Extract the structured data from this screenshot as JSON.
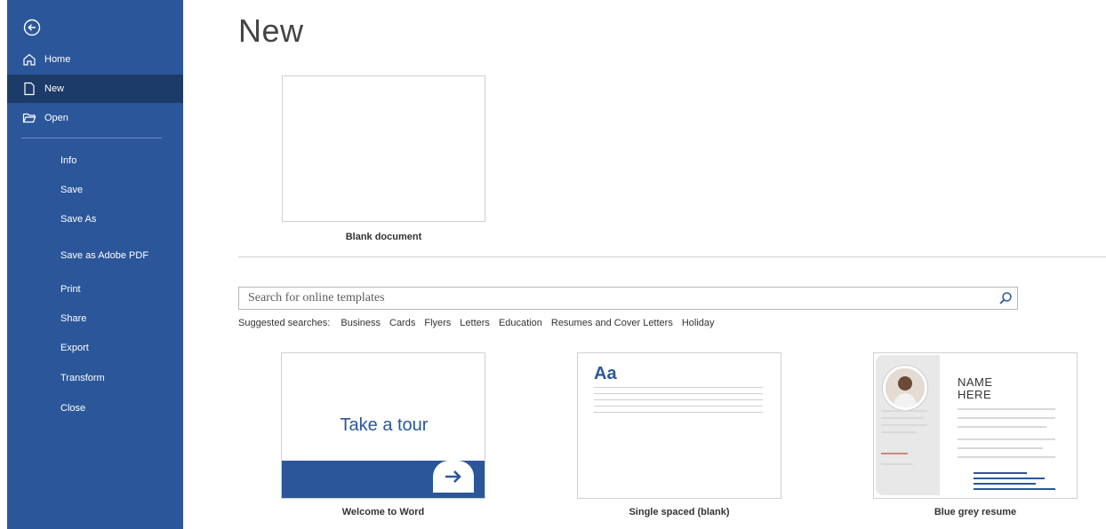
{
  "sidebar": {
    "back_icon": "back-arrow-circle-icon",
    "items": [
      {
        "label": "Home",
        "icon": "home-icon"
      },
      {
        "label": "New",
        "icon": "new-document-icon",
        "selected": true
      },
      {
        "label": "Open",
        "icon": "open-folder-icon"
      },
      {
        "label": "Info"
      },
      {
        "label": "Save"
      },
      {
        "label": "Save As"
      },
      {
        "label": "Save as Adobe PDF"
      },
      {
        "label": "Print"
      },
      {
        "label": "Share"
      },
      {
        "label": "Export"
      },
      {
        "label": "Transform"
      },
      {
        "label": "Close"
      }
    ]
  },
  "main": {
    "title": "New",
    "blank": {
      "label": "Blank document"
    },
    "search": {
      "placeholder": "Search for online templates",
      "icon": "search-icon"
    },
    "suggested": {
      "label": "Suggested searches:",
      "items": [
        "Business",
        "Cards",
        "Flyers",
        "Letters",
        "Education",
        "Resumes and Cover Letters",
        "Holiday"
      ]
    },
    "templates": [
      {
        "label": "Welcome to Word",
        "preview_text": "Take a tour"
      },
      {
        "label": "Single spaced (blank)",
        "preview_text": "Aa"
      },
      {
        "label": "Blue grey resume",
        "preview_text": "NAME HERE"
      }
    ]
  },
  "colors": {
    "accent": "#2b579a",
    "selected": "#1c3b68"
  }
}
